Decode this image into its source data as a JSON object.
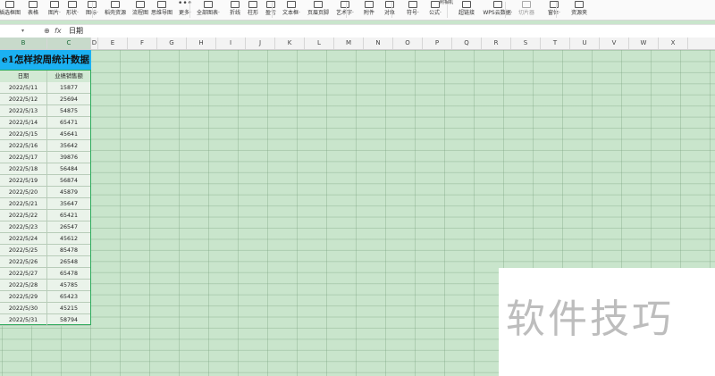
{
  "ribbon": {
    "items": [
      {
        "label": "插选框图",
        "icon": "shapes-icon"
      },
      {
        "label": "表格",
        "icon": "table-icon"
      },
      {
        "label": "图片·",
        "icon": "picture-icon"
      },
      {
        "label": "形状·",
        "icon": "shape-icon"
      },
      {
        "label": "图标·",
        "icon": "icons-icon"
      },
      {
        "label": "稻壳资源",
        "icon": "resource-icon"
      },
      {
        "label": "流程图",
        "icon": "flowchart-icon"
      },
      {
        "label": "思维导图",
        "icon": "mindmap-icon"
      },
      {
        "label": "更多·",
        "icon": "more-icon"
      },
      {
        "label": "全部图表·",
        "icon": "chart-icon"
      },
      {
        "label": "折线",
        "icon": "line-chart-icon"
      },
      {
        "label": "柱形",
        "icon": "column-chart-icon"
      },
      {
        "label": "盈亏",
        "icon": "winloss-icon"
      },
      {
        "label": "文本框·",
        "icon": "textbox-icon"
      },
      {
        "label": "页眉页脚",
        "icon": "header-footer-icon"
      },
      {
        "label": "艺术字·",
        "icon": "wordart-icon"
      },
      {
        "label": "附件",
        "icon": "attachment-icon"
      },
      {
        "label": "对象",
        "icon": "object-icon"
      },
      {
        "label": "符号·",
        "icon": "symbol-icon"
      },
      {
        "label": "公式·",
        "icon": "formula-icon"
      },
      {
        "label": "超链接",
        "icon": "hyperlink-icon"
      },
      {
        "label": "WPS云数据·",
        "icon": "cloud-data-icon"
      },
      {
        "label": "切片器",
        "icon": "slicer-icon"
      },
      {
        "label": "窗体·",
        "icon": "form-icon"
      },
      {
        "label": "资源夹",
        "icon": "resource-folder-icon"
      }
    ],
    "top_small_label": "照相机"
  },
  "formula_bar": {
    "name_box": "",
    "zoom_icon": "⊕",
    "fx_label": "fx",
    "value": "日期"
  },
  "columns": [
    "B",
    "C",
    "D",
    "E",
    "F",
    "G",
    "H",
    "I",
    "J",
    "K",
    "L",
    "M",
    "N",
    "O",
    "P",
    "Q",
    "R",
    "S",
    "T",
    "U",
    "V",
    "W",
    "X"
  ],
  "sheet": {
    "title": "e1怎样按周统计数据",
    "header": [
      "日期",
      "业绩销售额"
    ],
    "rows": [
      [
        "2022/5/11",
        "15877"
      ],
      [
        "2022/5/12",
        "25694"
      ],
      [
        "2022/5/13",
        "54875"
      ],
      [
        "2022/5/14",
        "65471"
      ],
      [
        "2022/5/15",
        "45641"
      ],
      [
        "2022/5/16",
        "35642"
      ],
      [
        "2022/5/17",
        "39876"
      ],
      [
        "2022/5/18",
        "56484"
      ],
      [
        "2022/5/19",
        "56874"
      ],
      [
        "2022/5/20",
        "45879"
      ],
      [
        "2022/5/21",
        "35647"
      ],
      [
        "2022/5/22",
        "65421"
      ],
      [
        "2022/5/23",
        "26547"
      ],
      [
        "2022/5/24",
        "45612"
      ],
      [
        "2022/5/25",
        "85478"
      ],
      [
        "2022/5/26",
        "26548"
      ],
      [
        "2022/5/27",
        "65478"
      ],
      [
        "2022/5/28",
        "45785"
      ],
      [
        "2022/5/29",
        "65423"
      ],
      [
        "2022/5/30",
        "45215"
      ],
      [
        "2022/5/31",
        "58794"
      ]
    ]
  },
  "watermark": "软件技巧",
  "colors": {
    "title_fill": "#1bb1f2",
    "sheet_bg": "#c9e5cc",
    "selection_border": "#2eaa5c"
  }
}
